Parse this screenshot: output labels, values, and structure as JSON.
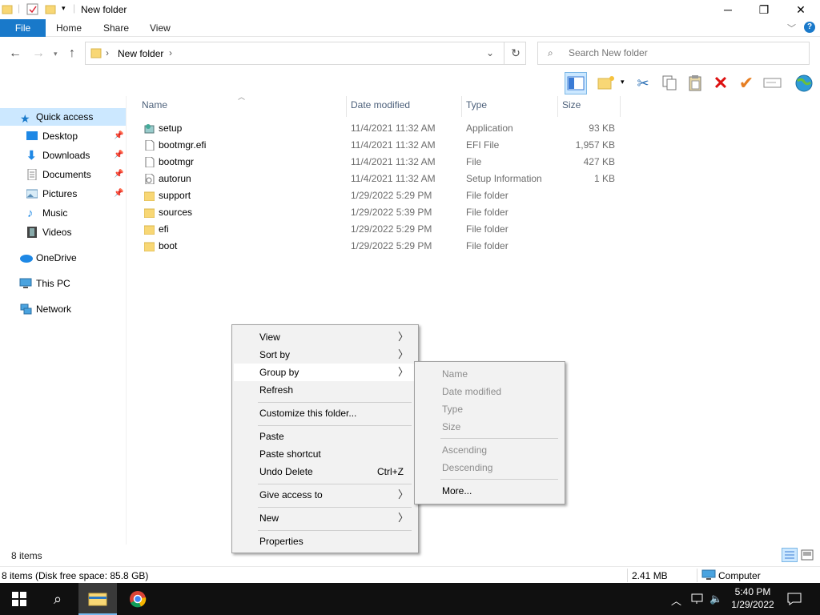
{
  "window": {
    "title": "New folder",
    "controls": {
      "minimize": "─",
      "maximize": "❐",
      "close": "✕"
    }
  },
  "ribbon": {
    "tabs": [
      {
        "label": "File"
      },
      {
        "label": "Home"
      },
      {
        "label": "Share"
      },
      {
        "label": "View"
      }
    ],
    "help": "?"
  },
  "address": {
    "breadcrumb": "New folder",
    "search_placeholder": "Search New folder"
  },
  "toolbar": {
    "icons": [
      "details-pane-icon",
      "new-folder-icon",
      "cut-icon",
      "copy-icon",
      "paste-icon",
      "delete-icon",
      "check-icon",
      "rename-icon",
      "globe-icon"
    ]
  },
  "sidebar": {
    "items": [
      {
        "label": "Quick access",
        "icon": "star-icon",
        "pinned": false
      },
      {
        "label": "Desktop",
        "icon": "desktop-icon",
        "pinned": true
      },
      {
        "label": "Downloads",
        "icon": "download-icon",
        "pinned": true
      },
      {
        "label": "Documents",
        "icon": "documents-icon",
        "pinned": true
      },
      {
        "label": "Pictures",
        "icon": "pictures-icon",
        "pinned": true
      },
      {
        "label": "Music",
        "icon": "music-icon",
        "pinned": false
      },
      {
        "label": "Videos",
        "icon": "videos-icon",
        "pinned": false
      },
      {
        "label": "OneDrive",
        "icon": "cloud-icon",
        "pinned": false
      },
      {
        "label": "This PC",
        "icon": "computer-icon",
        "pinned": false
      },
      {
        "label": "Network",
        "icon": "network-icon",
        "pinned": false
      }
    ]
  },
  "columns": {
    "name": "Name",
    "date": "Date modified",
    "type": "Type",
    "size": "Size"
  },
  "files": [
    {
      "name": "setup",
      "date": "11/4/2021 11:32 AM",
      "type": "Application",
      "size": "93 KB",
      "icon": "setup-icon"
    },
    {
      "name": "bootmgr.efi",
      "date": "11/4/2021 11:32 AM",
      "type": "EFI File",
      "size": "1,957 KB",
      "icon": "file-icon"
    },
    {
      "name": "bootmgr",
      "date": "11/4/2021 11:32 AM",
      "type": "File",
      "size": "427 KB",
      "icon": "file-icon"
    },
    {
      "name": "autorun",
      "date": "11/4/2021 11:32 AM",
      "type": "Setup Information",
      "size": "1 KB",
      "icon": "settings-file-icon"
    },
    {
      "name": "support",
      "date": "1/29/2022 5:29 PM",
      "type": "File folder",
      "size": "",
      "icon": "folder-icon"
    },
    {
      "name": "sources",
      "date": "1/29/2022 5:39 PM",
      "type": "File folder",
      "size": "",
      "icon": "folder-icon"
    },
    {
      "name": "efi",
      "date": "1/29/2022 5:29 PM",
      "type": "File folder",
      "size": "",
      "icon": "folder-icon"
    },
    {
      "name": "boot",
      "date": "1/29/2022 5:29 PM",
      "type": "File folder",
      "size": "",
      "icon": "folder-icon"
    }
  ],
  "context_menu": {
    "items": [
      {
        "label": "View",
        "submenu": true
      },
      {
        "label": "Sort by",
        "submenu": true
      },
      {
        "label": "Group by",
        "submenu": true,
        "highlighted": true
      },
      {
        "label": "Refresh"
      },
      {
        "label": "Customize this folder..."
      },
      {
        "label": "Paste"
      },
      {
        "label": "Paste shortcut"
      },
      {
        "label": "Undo Delete",
        "shortcut": "Ctrl+Z"
      },
      {
        "label": "Give access to",
        "submenu": true
      },
      {
        "label": "New",
        "submenu": true
      },
      {
        "label": "Properties"
      }
    ]
  },
  "group_by_menu": {
    "items": [
      {
        "label": "Name",
        "disabled": true
      },
      {
        "label": "Date modified",
        "disabled": true
      },
      {
        "label": "Type",
        "disabled": true
      },
      {
        "label": "Size",
        "disabled": true
      },
      {
        "label": "Ascending",
        "disabled": true
      },
      {
        "label": "Descending",
        "disabled": true
      },
      {
        "label": "More...",
        "disabled": false
      }
    ]
  },
  "status": {
    "item_count": "8 items",
    "details": "8 items (Disk free space: 85.8 GB)",
    "size": "2.41 MB",
    "location": "Computer"
  },
  "taskbar": {
    "time": "5:40 PM",
    "date": "1/29/2022"
  },
  "colors": {
    "accent": "#1979ca",
    "selection": "#cce8ff",
    "folder": "#f8d775",
    "taskbar": "#101010"
  }
}
